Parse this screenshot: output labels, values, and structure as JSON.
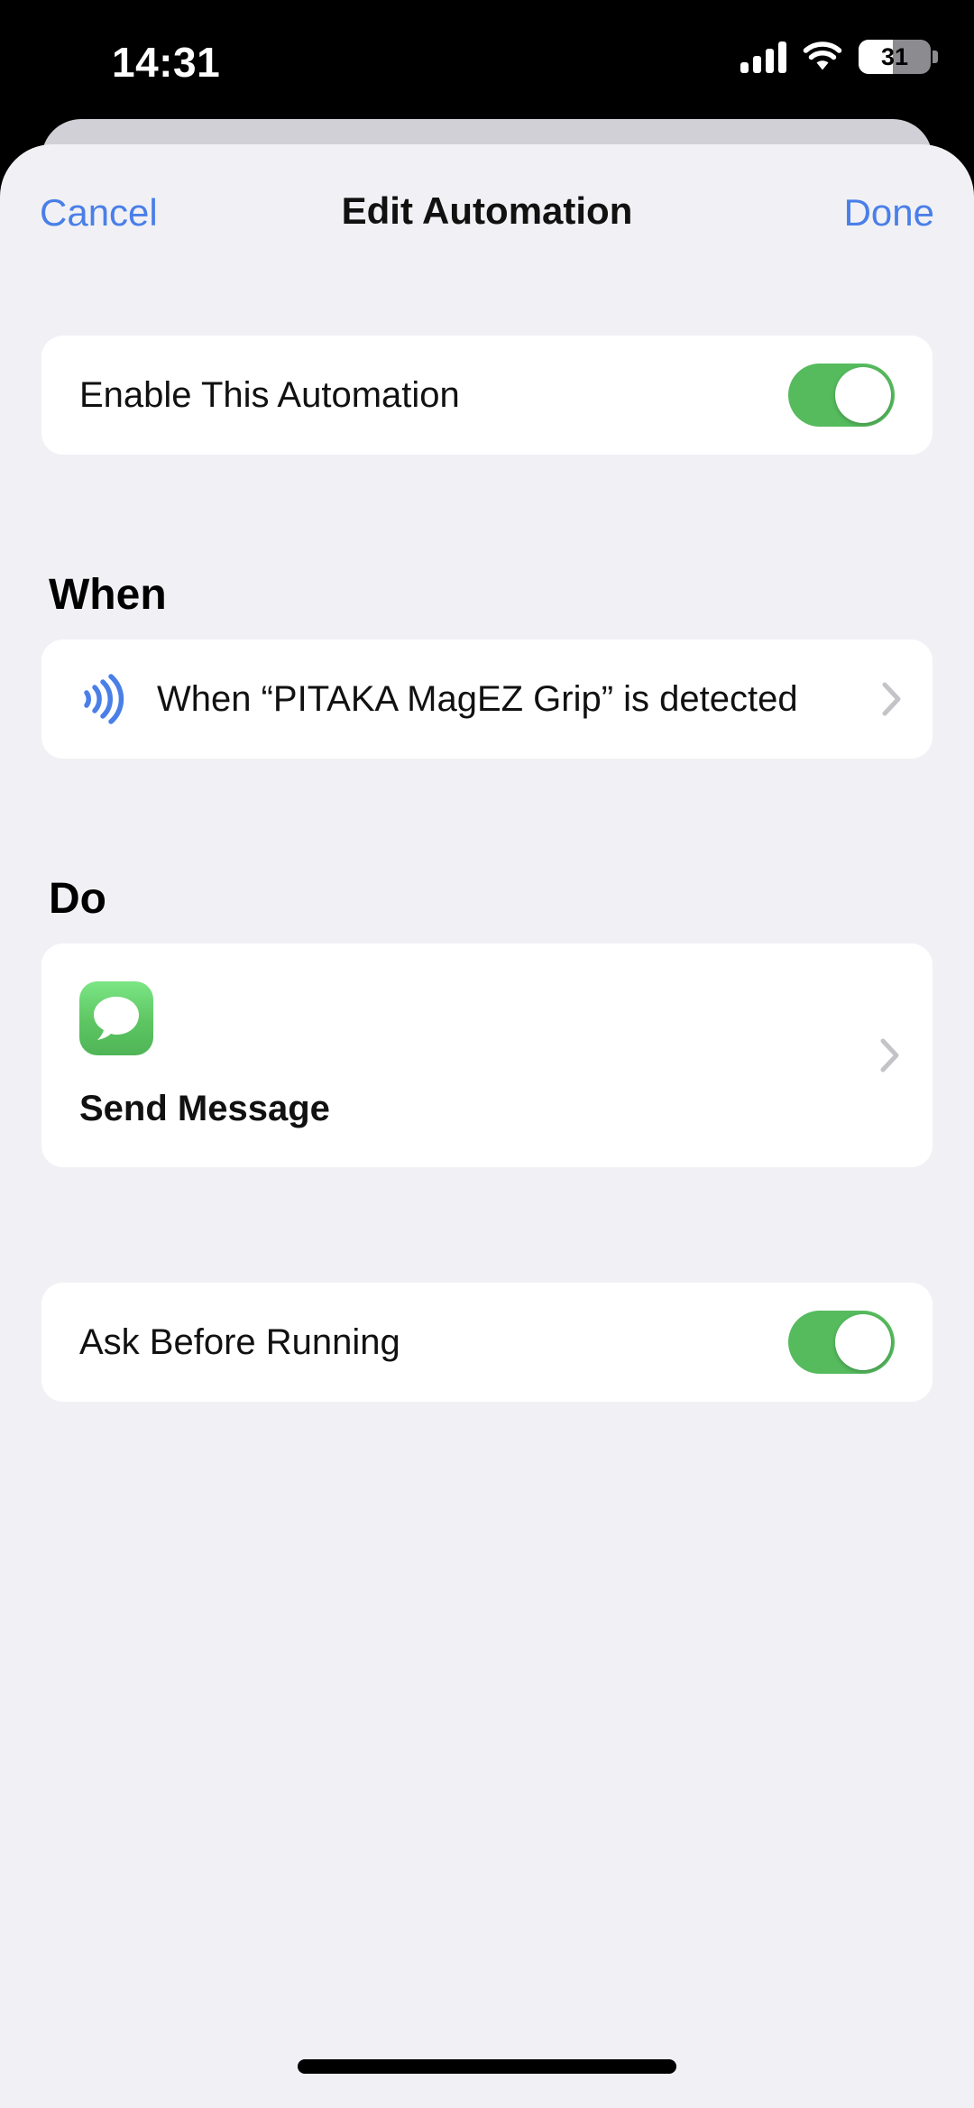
{
  "status_bar": {
    "time": "14:31",
    "battery_percent": "31",
    "signal_icon": "cellular-signal-icon",
    "wifi_icon": "wifi-icon",
    "battery_icon": "battery-icon",
    "signal_bars": 4
  },
  "nav": {
    "cancel_label": "Cancel",
    "title": "Edit Automation",
    "done_label": "Done"
  },
  "enable_row": {
    "label": "Enable This Automation",
    "toggle_state": "on"
  },
  "when": {
    "section_title": "When",
    "trigger_text": "When “PITAKA MagEZ Grip” is detected",
    "trigger_icon": "nfc-icon",
    "chevron_icon": "chevron-right-icon"
  },
  "do": {
    "section_title": "Do",
    "action_title": "Send Message",
    "action_icon": "messages-app-icon",
    "chevron_icon": "chevron-right-icon"
  },
  "ask_row": {
    "label": "Ask Before Running",
    "toggle_state": "on"
  },
  "colors": {
    "accent_blue": "#4a7fe8",
    "toggle_green": "#55bb5d",
    "sheet_background": "#f1f1f5",
    "card_background": "#ffffff",
    "nfc_blue": "#4a7fe8",
    "messages_green": "#5dc662",
    "chevron_gray": "#c4c4c8"
  }
}
